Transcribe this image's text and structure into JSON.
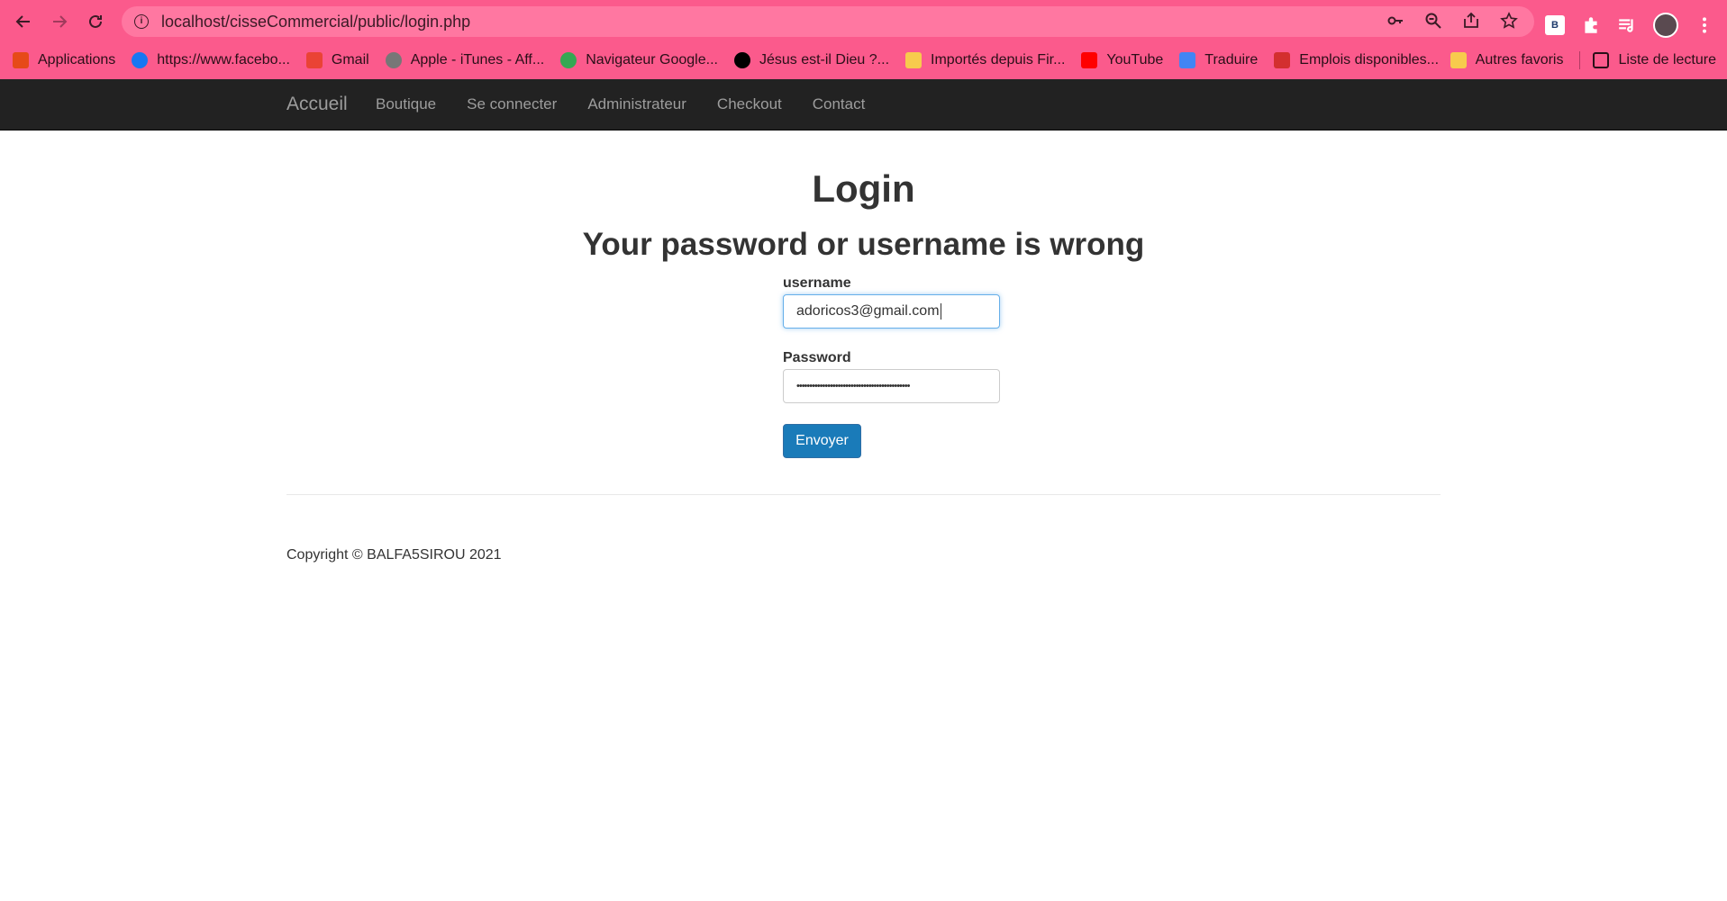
{
  "browser": {
    "url": "localhost/cisseCommercial/public/login.php",
    "bookmarks": [
      {
        "label": "Applications",
        "icon": "apps-grid-icon",
        "color": "#e64a19"
      },
      {
        "label": "https://www.facebo...",
        "icon": "facebook-icon",
        "color": "#1877f2"
      },
      {
        "label": "Gmail",
        "icon": "gmail-icon",
        "color": "#ea4335"
      },
      {
        "label": "Apple - iTunes - Aff...",
        "icon": "apple-icon",
        "color": "#777777"
      },
      {
        "label": "Navigateur Google...",
        "icon": "chrome-icon",
        "color": "#34a853"
      },
      {
        "label": "Jésus est-il Dieu ?...",
        "icon": "g-logo-icon",
        "color": "#000000"
      },
      {
        "label": "Importés depuis Fir...",
        "icon": "folder-icon",
        "color": "#f7cb4d"
      },
      {
        "label": "YouTube",
        "icon": "youtube-icon",
        "color": "#ff0000"
      },
      {
        "label": "Traduire",
        "icon": "translate-icon",
        "color": "#4285f4"
      },
      {
        "label": "Emplois disponibles...",
        "icon": "jobs-icon",
        "color": "#d32f2f"
      }
    ],
    "other_bookmarks": "Autres favoris",
    "reading_list": "Liste de lecture",
    "extension_b": "B"
  },
  "navbar": {
    "brand": "Accueil",
    "links": [
      "Boutique",
      "Se connecter",
      "Administrateur",
      "Checkout",
      "Contact"
    ]
  },
  "page": {
    "title": "Login",
    "error": "Your password or username is wrong",
    "username_label": "username",
    "username_value": "adoricos3@gmail.com",
    "password_label": "Password",
    "password_value": "••••••••••••••••••••••••••••••••••••••••••••",
    "submit_label": "Envoyer",
    "footer": "Copyright © BALFA5SIROU 2021"
  },
  "colors": {
    "browser_accent": "#fb5a8c",
    "navbar_bg": "#222222",
    "button_bg": "#1a7bb9"
  }
}
